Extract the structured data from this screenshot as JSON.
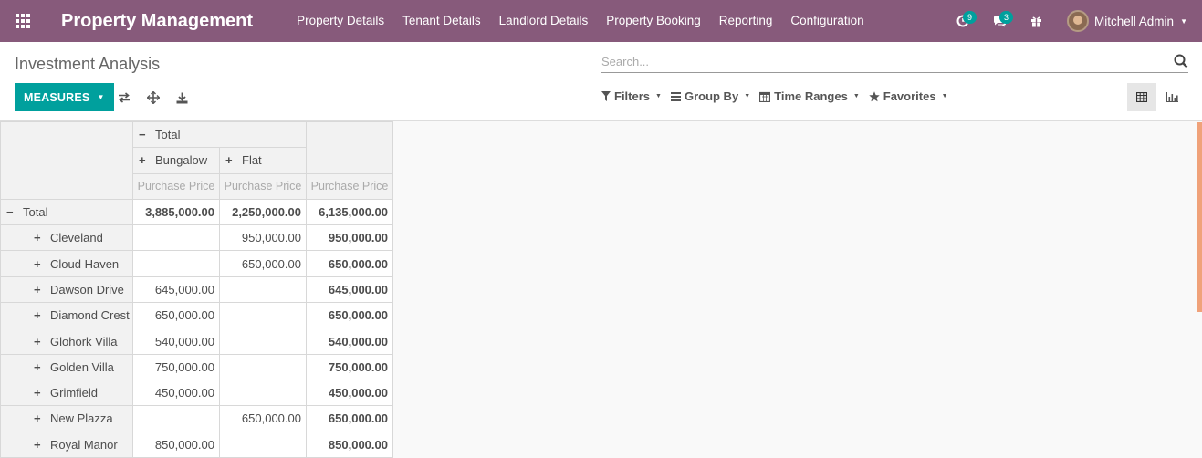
{
  "navbar": {
    "brand": "Property Management",
    "menu": [
      "Property Details",
      "Tenant Details",
      "Landlord Details",
      "Property Booking",
      "Reporting",
      "Configuration"
    ],
    "activity_count": "9",
    "messages_count": "3",
    "user_name": "Mitchell Admin"
  },
  "control_panel": {
    "breadcrumb": "Investment Analysis",
    "search_placeholder": "Search...",
    "measures_label": "MEASURES",
    "filters": [
      "Filters",
      "Group By",
      "Time Ranges",
      "Favorites"
    ]
  },
  "pivot": {
    "col_total_label": "Total",
    "col_groups": [
      "Bungalow",
      "Flat"
    ],
    "measure_label": "Purchase Price",
    "row_total_label": "Total",
    "grand": {
      "bungalow": "3,885,000.00",
      "flat": "2,250,000.00",
      "total": "6,135,000.00"
    },
    "rows": [
      {
        "label": "Cleveland",
        "bungalow": "",
        "flat": "950,000.00",
        "total": "950,000.00"
      },
      {
        "label": "Cloud Haven",
        "bungalow": "",
        "flat": "650,000.00",
        "total": "650,000.00"
      },
      {
        "label": "Dawson Drive",
        "bungalow": "645,000.00",
        "flat": "",
        "total": "645,000.00"
      },
      {
        "label": "Diamond Crest",
        "bungalow": "650,000.00",
        "flat": "",
        "total": "650,000.00"
      },
      {
        "label": "Glohork Villa",
        "bungalow": "540,000.00",
        "flat": "",
        "total": "540,000.00"
      },
      {
        "label": "Golden Villa",
        "bungalow": "750,000.00",
        "flat": "",
        "total": "750,000.00"
      },
      {
        "label": "Grimfield",
        "bungalow": "450,000.00",
        "flat": "",
        "total": "450,000.00"
      },
      {
        "label": "New Plazza",
        "bungalow": "",
        "flat": "650,000.00",
        "total": "650,000.00"
      },
      {
        "label": "Royal Manor",
        "bungalow": "850,000.00",
        "flat": "",
        "total": "850,000.00"
      }
    ]
  },
  "colors": {
    "navbar": "#875a7b",
    "primary_button": "#00a09d",
    "badge": "#00a09d"
  }
}
